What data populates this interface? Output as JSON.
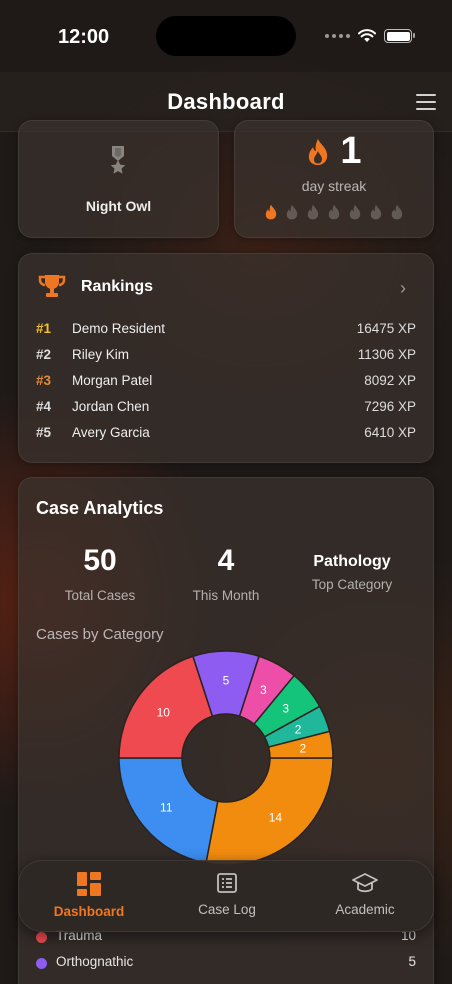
{
  "status": {
    "time": "12:00"
  },
  "header": {
    "title": "Dashboard"
  },
  "badge": {
    "name": "Night Owl",
    "icon": "medal-icon"
  },
  "streak": {
    "count": "1",
    "label": "day streak",
    "days_total": 7,
    "days_active": 1
  },
  "rankings": {
    "title": "Rankings",
    "rows": [
      {
        "pos": "#1",
        "name": "Demo Resident",
        "xp": "16475 XP",
        "color": "#f5c02b"
      },
      {
        "pos": "#2",
        "name": "Riley Kim",
        "xp": "11306 XP",
        "color": "#dddddd"
      },
      {
        "pos": "#3",
        "name": "Morgan Patel",
        "xp": "8092 XP",
        "color": "#e58a3a"
      },
      {
        "pos": "#4",
        "name": "Jordan Chen",
        "xp": "7296 XP",
        "color": "#dddddd"
      },
      {
        "pos": "#5",
        "name": "Avery Garcia",
        "xp": "6410 XP",
        "color": "#dddddd"
      }
    ]
  },
  "analytics": {
    "title": "Case Analytics",
    "total_cases": "50",
    "total_cases_label": "Total Cases",
    "this_month": "4",
    "this_month_label": "This Month",
    "top_category": "Pathology",
    "top_category_label": "Top Category",
    "category_title": "Cases by Category"
  },
  "chart_data": {
    "type": "pie",
    "values": [
      14,
      11,
      10,
      5,
      3,
      3,
      2,
      2
    ],
    "colors": [
      "#f28c0f",
      "#3d8ef0",
      "#ef4a4f",
      "#8f5cf2",
      "#ec4ea8",
      "#14c47b",
      "#1fb89a",
      "#f28c0f"
    ]
  },
  "legend": [
    {
      "name": "Trauma",
      "value": "10",
      "color": "#ef4a4f"
    },
    {
      "name": "Orthognathic",
      "value": "5",
      "color": "#8f5cf2"
    }
  ],
  "tabs": [
    {
      "label": "Dashboard",
      "icon": "dashboard-icon",
      "active": true
    },
    {
      "label": "Case Log",
      "icon": "case-log-icon",
      "active": false
    },
    {
      "label": "Academic",
      "icon": "graduation-cap-icon",
      "active": false
    }
  ],
  "colors": {
    "accent": "#f07722",
    "gold": "#f5c02b",
    "bronze": "#e58a3a"
  }
}
